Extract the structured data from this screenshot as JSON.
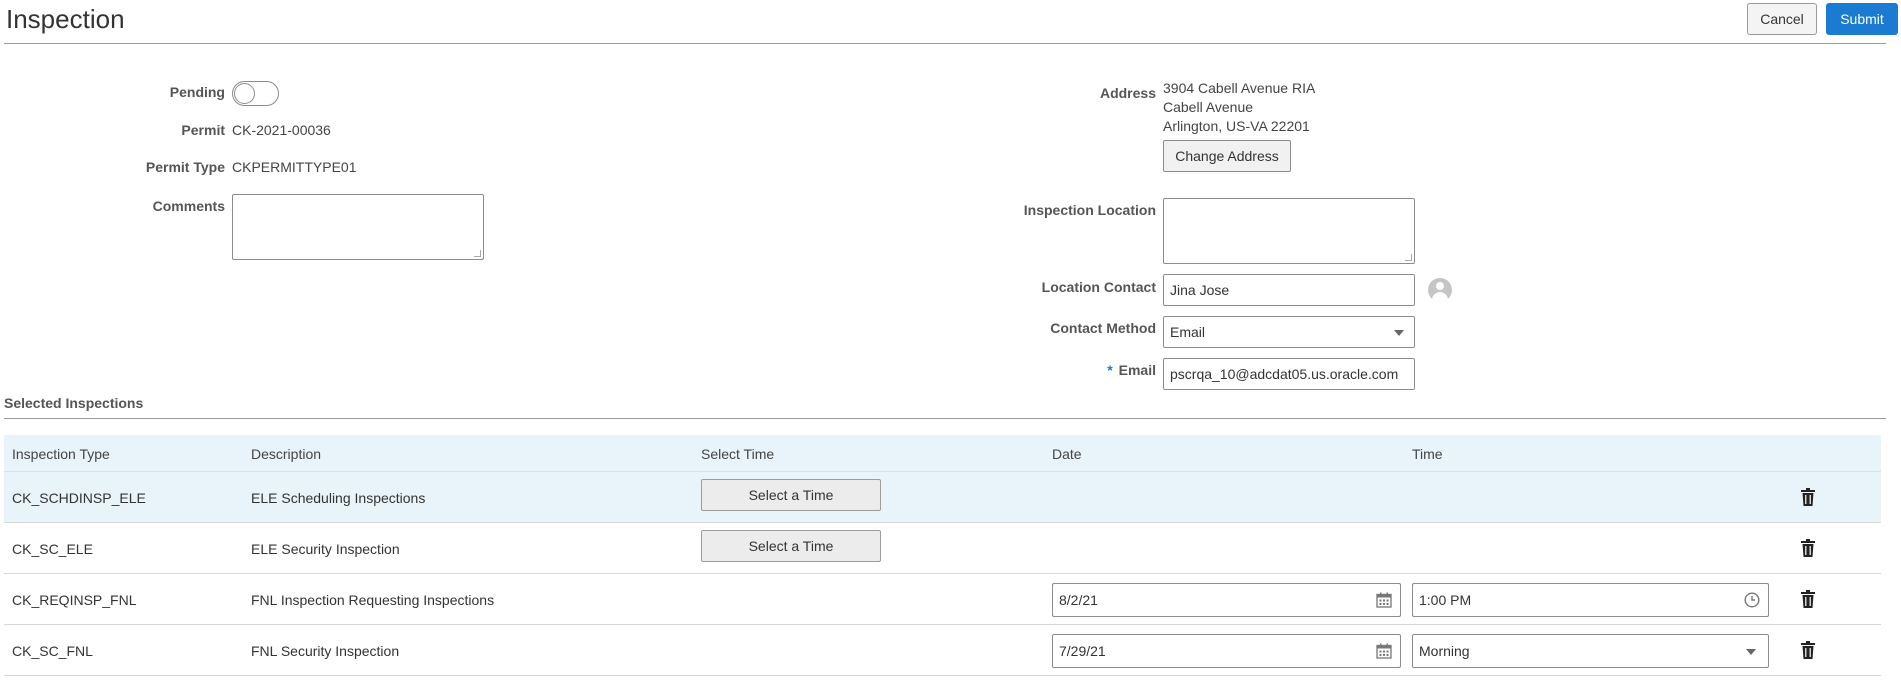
{
  "header": {
    "title": "Inspection",
    "cancel_label": "Cancel",
    "submit_label": "Submit"
  },
  "form": {
    "pending_label": "Pending",
    "pending_on": false,
    "permit_label": "Permit",
    "permit_value": "CK-2021-00036",
    "permit_type_label": "Permit Type",
    "permit_type_value": "CKPERMITTYPE01",
    "comments_label": "Comments",
    "comments_value": "",
    "address_label": "Address",
    "address_lines": [
      "3904 Cabell Avenue RIA",
      "Cabell Avenue",
      "Arlington, US-VA 22201"
    ],
    "change_address_label": "Change Address",
    "inspection_location_label": "Inspection Location",
    "inspection_location_value": "",
    "location_contact_label": "Location Contact",
    "location_contact_value": "Jina  Jose",
    "contact_method_label": "Contact Method",
    "contact_method_value": "Email",
    "email_label": "Email",
    "email_required_marker": "*",
    "email_value": "pscrqa_10@adcdat05.us.oracle.com"
  },
  "selected_inspections": {
    "title": "Selected Inspections",
    "columns": [
      "Inspection Type",
      "Description",
      "Select Time",
      "Date",
      "Time"
    ],
    "select_time_label": "Select a Time",
    "rows": [
      {
        "type": "CK_SCHDINSP_ELE",
        "description": "ELE Scheduling Inspections",
        "date": "",
        "time": ""
      },
      {
        "type": "CK_SC_ELE",
        "description": "ELE Security Inspection",
        "date": "",
        "time": ""
      },
      {
        "type": "CK_REQINSP_FNL",
        "description": "FNL Inspection Requesting Inspections",
        "date": "8/2/21",
        "time": "1:00 PM"
      },
      {
        "type": "CK_SC_FNL",
        "description": "FNL Security Inspection",
        "date": "7/29/21",
        "time": "Morning"
      }
    ]
  },
  "colors": {
    "accent": "#1b7ad1",
    "row_highlight": "#e9f3fa"
  },
  "icons": [
    "user-avatar-icon",
    "chevron-down-icon",
    "calendar-icon",
    "clock-icon",
    "trash-icon"
  ]
}
